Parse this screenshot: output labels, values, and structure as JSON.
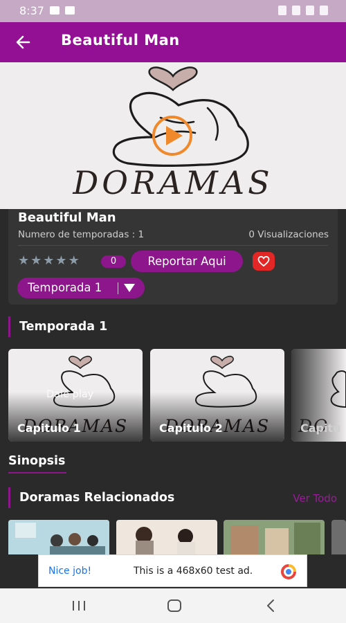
{
  "status_bar": {
    "time": "8:37"
  },
  "app_bar": {
    "title": "Beautiful Man",
    "back_icon": "arrow-left-icon"
  },
  "banner": {
    "logo_text": "DORAMAS",
    "play_icon": "play-icon"
  },
  "details": {
    "name": "Beautiful Man",
    "seasons_text": "Numero de temporadas : 1",
    "views_text": "0 Visualizaciones",
    "rating_count": "0",
    "rating_stars": 0,
    "report_label": "Reportar Aqui",
    "season_selected": "Temporada 1"
  },
  "episodes_section": {
    "title": "Temporada 1"
  },
  "episodes": [
    {
      "label": "Capitulo 1",
      "overlay": "Dale play"
    },
    {
      "label": "Capitulo 2",
      "overlay": ""
    },
    {
      "label": "Capitu",
      "overlay": ""
    }
  ],
  "synopsis": {
    "title": "Sinopsis"
  },
  "related": {
    "title": "Doramas Relacionados",
    "see_all": "Ver Todo"
  },
  "ad": {
    "nice": "Nice job!",
    "text": "This is a 468x60 test ad."
  },
  "colors": {
    "primary": "#930f93",
    "accent": "#8d168d",
    "background": "#2a2a2a",
    "favorite": "#e32626"
  }
}
